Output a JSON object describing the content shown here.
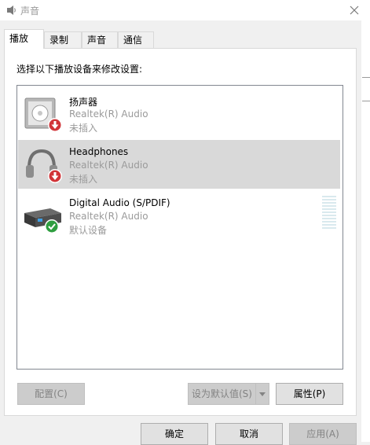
{
  "window": {
    "title": "声音"
  },
  "tabs": [
    {
      "label": "播放",
      "active": true
    },
    {
      "label": "录制",
      "active": false
    },
    {
      "label": "声音",
      "active": false
    },
    {
      "label": "通信",
      "active": false
    }
  ],
  "instruction": "选择以下播放设备来修改设置:",
  "devices": [
    {
      "name": "扬声器",
      "driver": "Realtek(R) Audio",
      "status": "未插入",
      "icon": "speaker-icon",
      "badge": "unplugged-badge-icon",
      "selected": false
    },
    {
      "name": "Headphones",
      "driver": "Realtek(R) Audio",
      "status": "未插入",
      "icon": "headphones-icon",
      "badge": "unplugged-badge-icon",
      "selected": true
    },
    {
      "name": "Digital Audio (S/PDIF)",
      "driver": "Realtek(R) Audio",
      "status": "默认设备",
      "icon": "digital-audio-icon",
      "badge": "default-check-icon",
      "selected": false
    }
  ],
  "panel_buttons": {
    "configure": "配置(C)",
    "set_default": "设为默认值(S)",
    "properties": "属性(P)"
  },
  "dialog_buttons": {
    "ok": "确定",
    "cancel": "取消",
    "apply": "应用(A)"
  },
  "colors": {
    "selection": "#d9d9d9",
    "badge_red": "#d13438",
    "badge_green": "#2e9e3f",
    "disabled_text": "#838383"
  }
}
